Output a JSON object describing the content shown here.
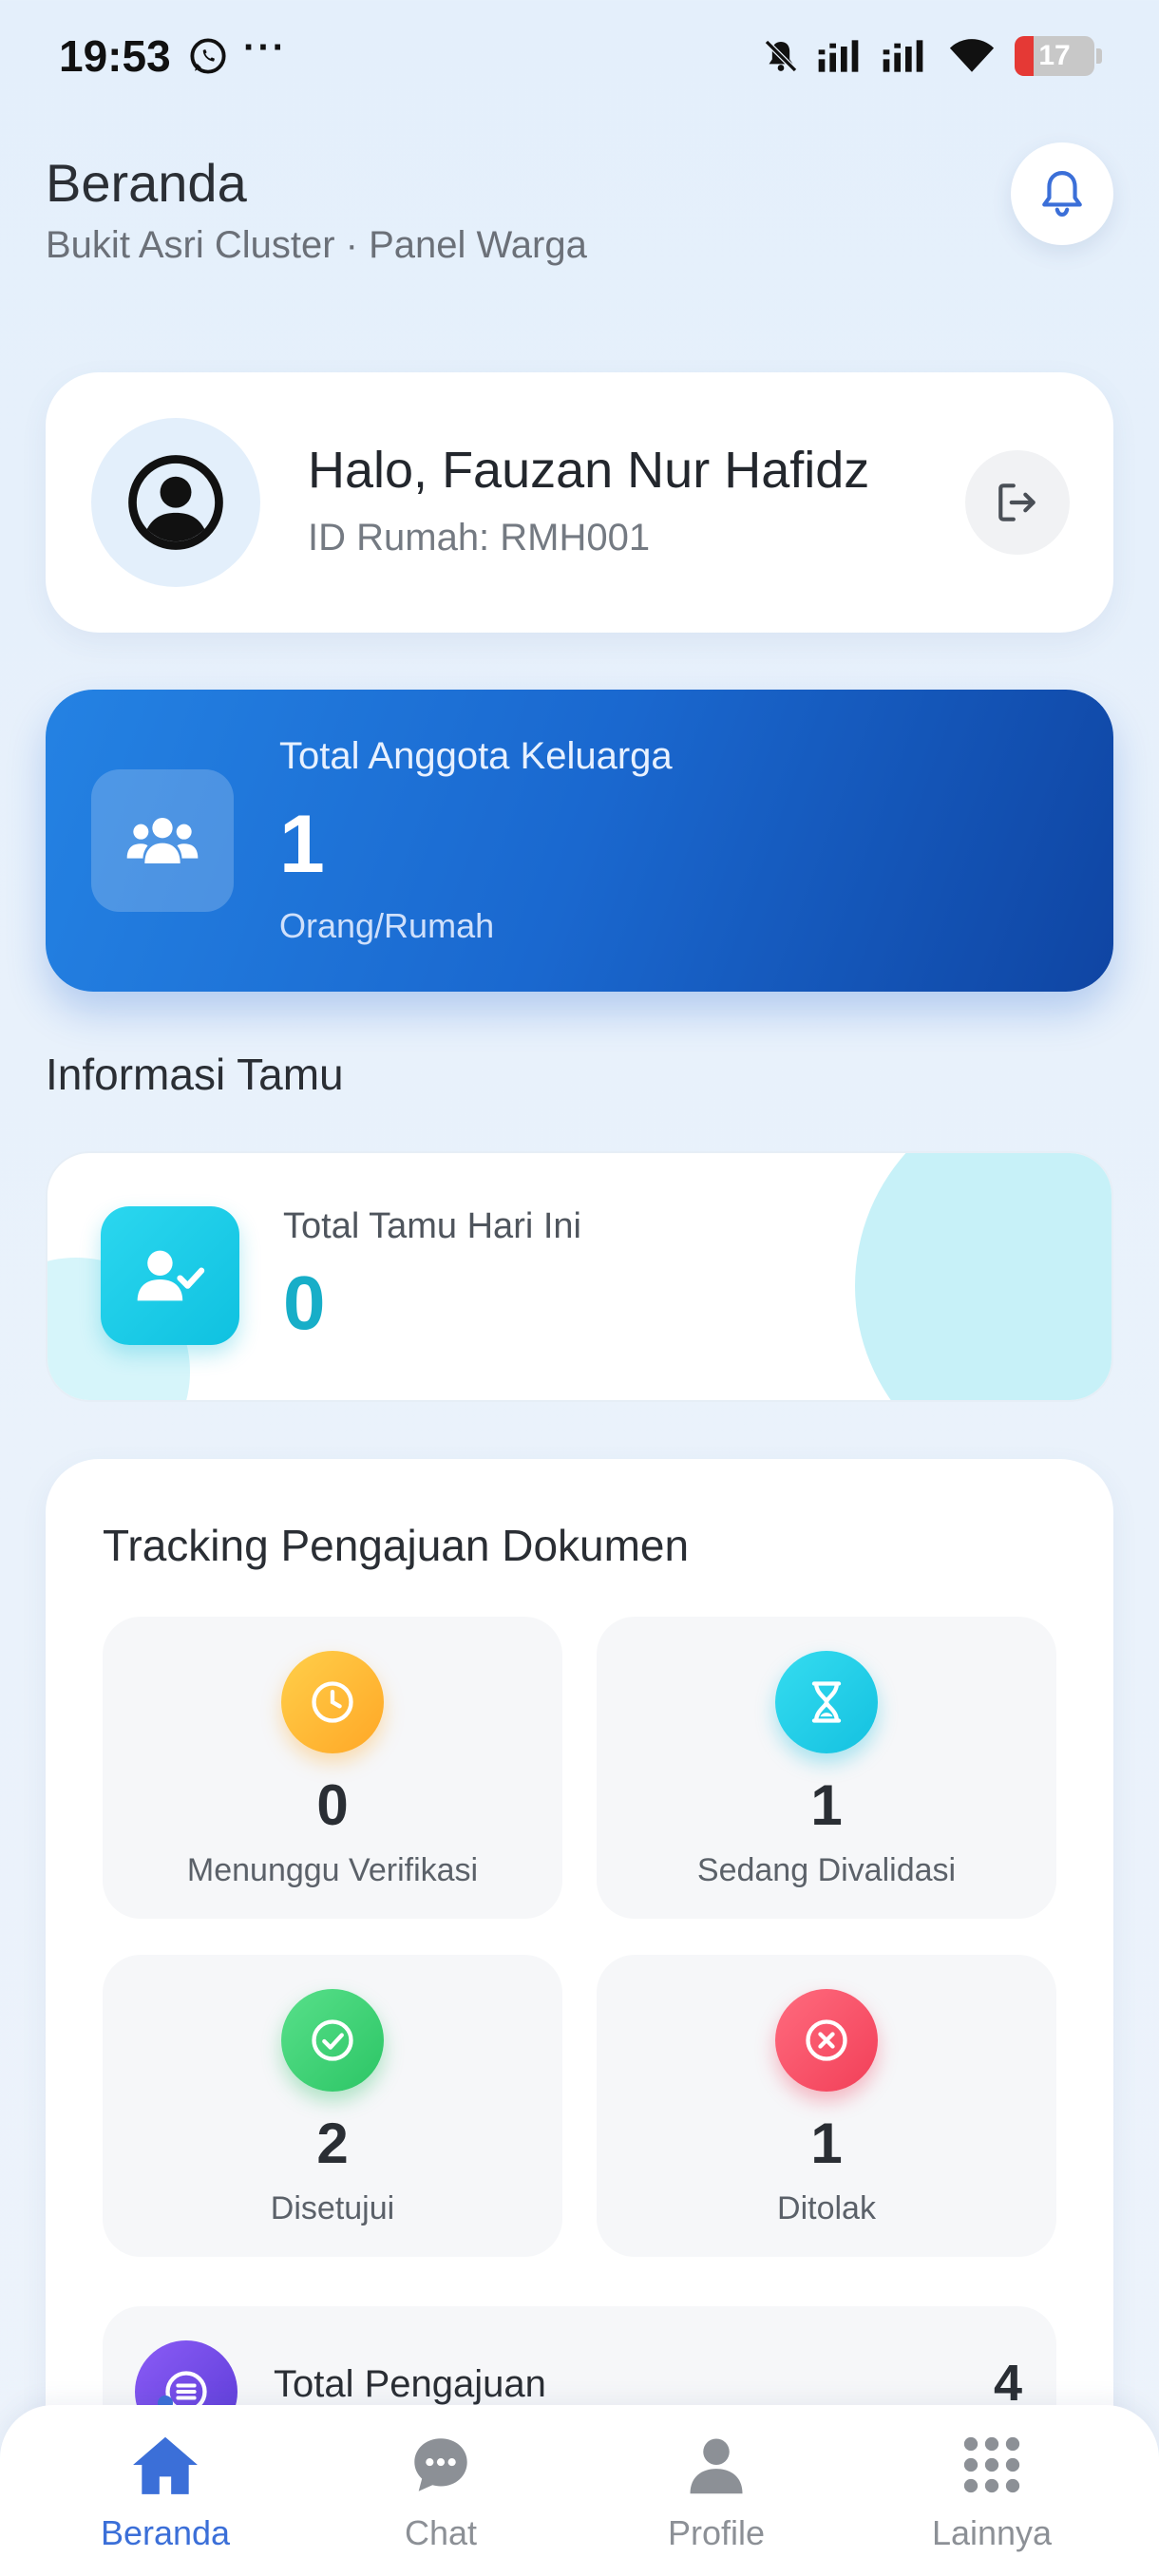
{
  "status_bar": {
    "time": "19:53",
    "dots": "···",
    "battery": "17"
  },
  "header": {
    "title": "Beranda",
    "subtitle": "Bukit Asri Cluster · Panel Warga"
  },
  "user": {
    "greeting": "Halo, Fauzan Nur Hafidz",
    "house_id": "ID Rumah: RMH001"
  },
  "family": {
    "label": "Total Anggota Keluarga",
    "value": "1",
    "unit": "Orang/Rumah"
  },
  "guest_section": {
    "title": "Informasi Tamu",
    "label": "Total Tamu Hari Ini",
    "value": "0"
  },
  "tracking": {
    "title": "Tracking Pengajuan Dokumen",
    "items": [
      {
        "value": "0",
        "label": "Menunggu Verifikasi",
        "color": "#ffb13a",
        "icon": "clock-icon"
      },
      {
        "value": "1",
        "label": "Sedang Divalidasi",
        "color": "#1fc8e6",
        "icon": "hourglass-icon"
      },
      {
        "value": "2",
        "label": "Disetujui",
        "color": "#3ad176",
        "icon": "check-circle-icon"
      },
      {
        "value": "1",
        "label": "Ditolak",
        "color": "#f5526a",
        "icon": "x-circle-icon"
      }
    ],
    "total_label": "Total Pengajuan",
    "total_value": "4"
  },
  "nav": {
    "items": [
      {
        "label": "Beranda",
        "icon": "home-icon",
        "active": true
      },
      {
        "label": "Chat",
        "icon": "chat-icon",
        "active": false
      },
      {
        "label": "Profile",
        "icon": "person-icon",
        "active": false
      },
      {
        "label": "Lainnya",
        "icon": "grid-icon",
        "active": false
      }
    ]
  },
  "colors": {
    "accent": "#3b6fd8",
    "family_card_start": "#2482e3",
    "family_card_end": "#0f45a3",
    "guest_value": "#17aec8"
  }
}
